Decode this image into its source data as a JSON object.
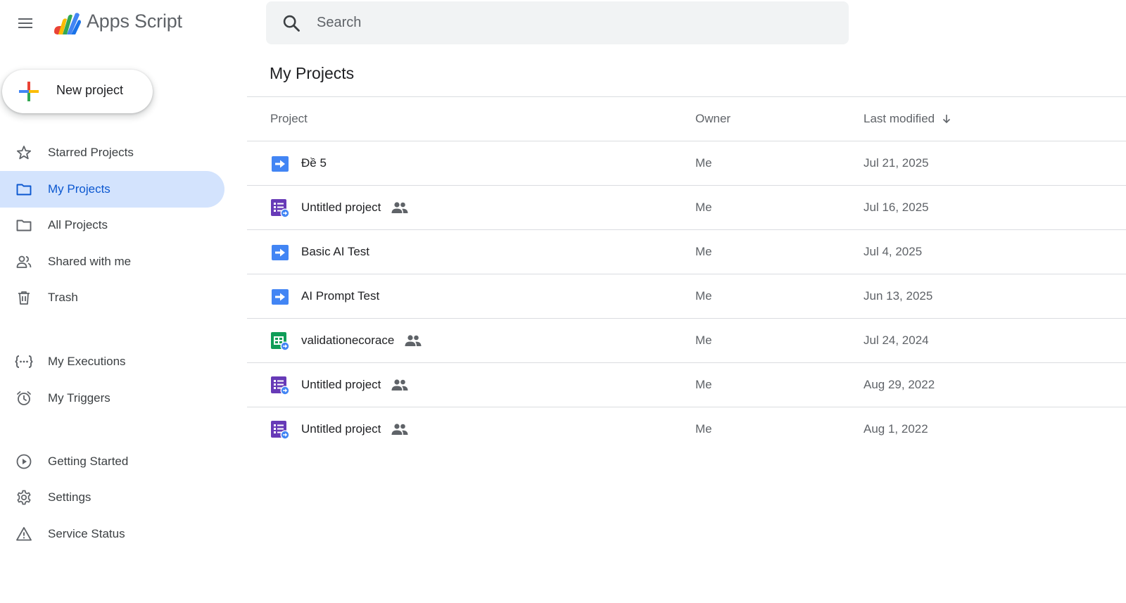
{
  "header": {
    "app_title": "Apps Script",
    "search_placeholder": "Search"
  },
  "sidebar": {
    "new_project_label": "New project",
    "items": [
      {
        "label": "Starred Projects",
        "icon": "star-icon",
        "active": false
      },
      {
        "label": "My Projects",
        "icon": "folder-icon",
        "active": true
      },
      {
        "label": "All Projects",
        "icon": "folder-icon",
        "active": false
      },
      {
        "label": "Shared with me",
        "icon": "people-icon",
        "active": false
      },
      {
        "label": "Trash",
        "icon": "trash-icon",
        "active": false
      },
      {
        "label": "My Executions",
        "icon": "executions-icon",
        "active": false
      },
      {
        "label": "My Triggers",
        "icon": "alarm-icon",
        "active": false
      },
      {
        "label": "Getting Started",
        "icon": "play-circle-icon",
        "active": false
      },
      {
        "label": "Settings",
        "icon": "gear-icon",
        "active": false
      },
      {
        "label": "Service Status",
        "icon": "warning-icon",
        "active": false
      }
    ]
  },
  "main": {
    "page_title": "My Projects",
    "columns": {
      "project": "Project",
      "owner": "Owner",
      "last_modified": "Last modified"
    },
    "rows": [
      {
        "name": "Đề 5",
        "owner": "Me",
        "modified": "Jul 21, 2025",
        "type": "standalone",
        "shared": false
      },
      {
        "name": "Untitled project",
        "owner": "Me",
        "modified": "Jul 16, 2025",
        "type": "forms",
        "shared": true
      },
      {
        "name": "Basic AI Test",
        "owner": "Me",
        "modified": "Jul 4, 2025",
        "type": "standalone",
        "shared": false
      },
      {
        "name": "AI Prompt Test",
        "owner": "Me",
        "modified": "Jun 13, 2025",
        "type": "standalone",
        "shared": false
      },
      {
        "name": "validationecorace",
        "owner": "Me",
        "modified": "Jul 24, 2024",
        "type": "sheets",
        "shared": true
      },
      {
        "name": "Untitled project",
        "owner": "Me",
        "modified": "Aug 29, 2022",
        "type": "forms",
        "shared": true
      },
      {
        "name": "Untitled project",
        "owner": "Me",
        "modified": "Aug 1, 2022",
        "type": "forms",
        "shared": true
      }
    ]
  },
  "colors": {
    "active_bg": "#d3e3fd",
    "active_text": "#0b57d0",
    "script_blue": "#4285f4",
    "forms_purple": "#673ab7",
    "sheets_green": "#0f9d58"
  }
}
